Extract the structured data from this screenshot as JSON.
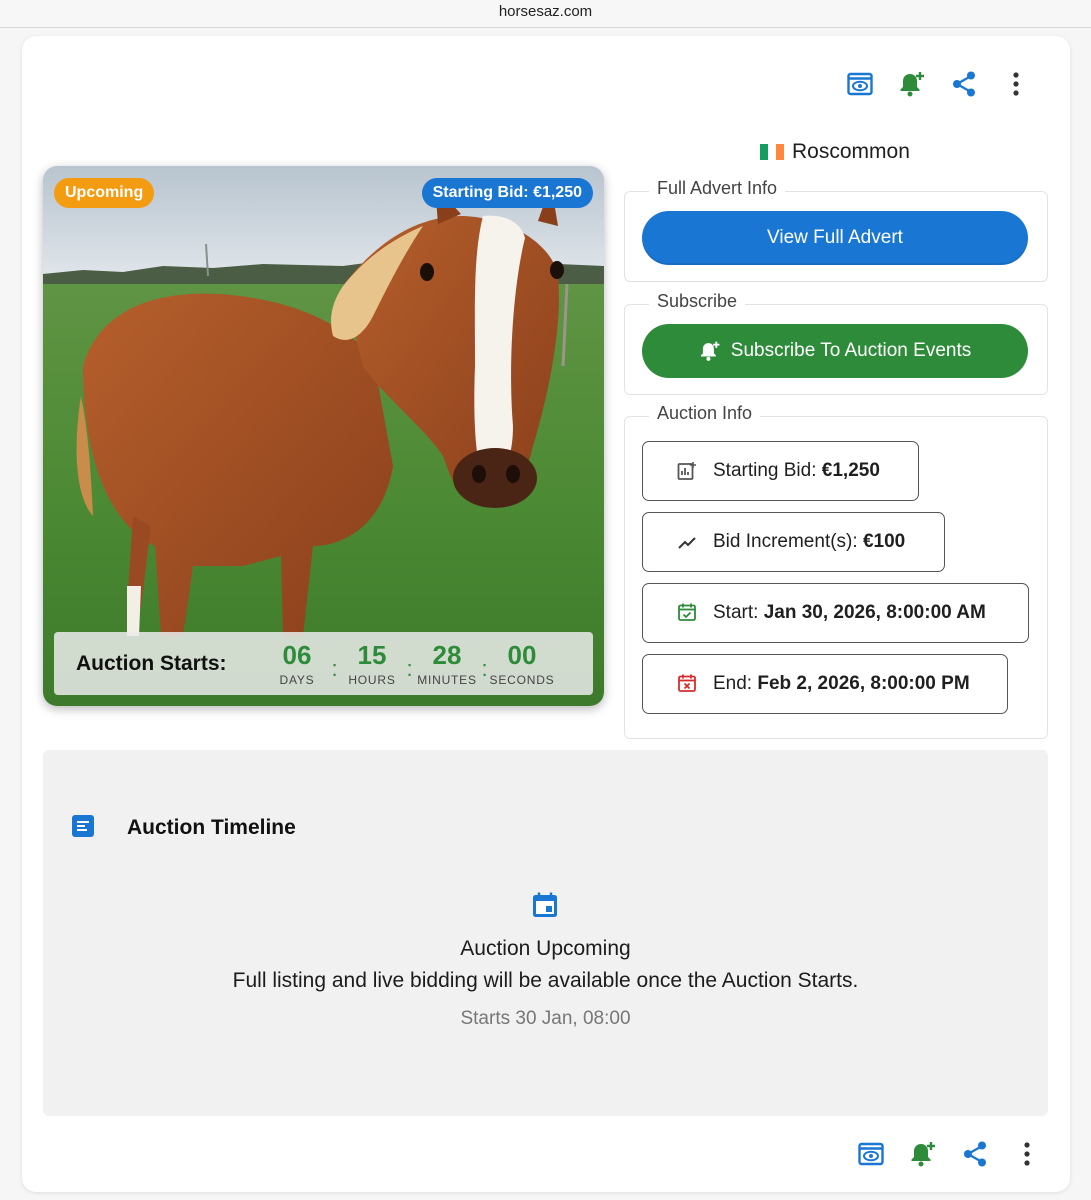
{
  "browser": {
    "url": "horsesaz.com"
  },
  "toolbar": {
    "icons": [
      "watch-icon",
      "subscribe-bell-icon",
      "share-icon",
      "more-vert-icon"
    ]
  },
  "listing": {
    "location": "Roscommon",
    "status_badge": "Upcoming",
    "starting_bid_badge": "Starting Bid: €1,250"
  },
  "countdown": {
    "label": "Auction Starts:",
    "days": "06",
    "days_label": "DAYS",
    "hours": "15",
    "hours_label": "HOURS",
    "minutes": "28",
    "minutes_label": "MINUTES",
    "seconds": "00",
    "seconds_label": "SECONDS"
  },
  "full_advert": {
    "legend": "Full Advert Info",
    "button": "View Full Advert"
  },
  "subscribe": {
    "legend": "Subscribe",
    "button": "Subscribe To Auction Events"
  },
  "auction_info": {
    "legend": "Auction Info",
    "starting_bid_label": "Starting Bid:",
    "starting_bid_value": "€1,250",
    "increment_label": "Bid Increment(s):",
    "increment_value": "€100",
    "start_label": "Start:",
    "start_value": "Jan 30, 2026, 8:00:00 AM",
    "end_label": "End:",
    "end_value": "Feb 2, 2026, 8:00:00 PM"
  },
  "timeline": {
    "title": "Auction Timeline",
    "heading": "Auction Upcoming",
    "message": "Full listing and live bidding will be available once the Auction Starts.",
    "starts": "Starts 30 Jan, 08:00"
  },
  "colors": {
    "primary_blue": "#1976d2",
    "success_green": "#2e8b3a",
    "warning_orange": "#f39c12",
    "danger_red": "#d32f2f"
  }
}
